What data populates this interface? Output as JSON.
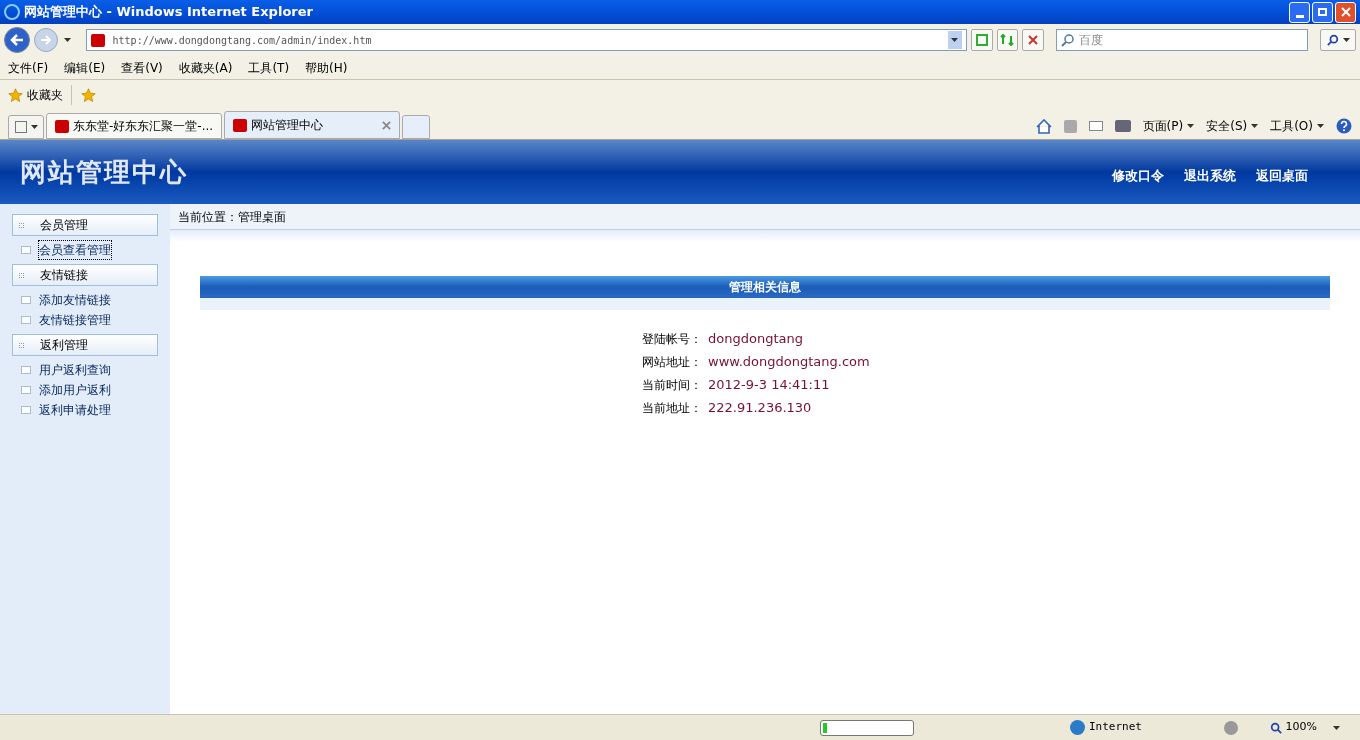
{
  "window": {
    "title": "网站管理中心 - Windows Internet Explorer"
  },
  "address": {
    "url": "http://www.dongdongtang.com/admin/index.htm"
  },
  "search": {
    "placeholder": "百度"
  },
  "menu": [
    "文件(F)",
    "编辑(E)",
    "查看(V)",
    "收藏夹(A)",
    "工具(T)",
    "帮助(H)"
  ],
  "favorites": {
    "label": "收藏夹"
  },
  "tabs": [
    {
      "label": "东东堂-好东东汇聚一堂-...",
      "selected": false
    },
    {
      "label": "网站管理中心",
      "selected": true
    }
  ],
  "command_bar": [
    "页面(P)",
    "安全(S)",
    "工具(O)"
  ],
  "header": {
    "title": "网站管理中心",
    "links": [
      "修改口令",
      "退出系统",
      "返回桌面"
    ]
  },
  "sidebar": {
    "groups": [
      {
        "title": "会员管理",
        "items": [
          {
            "label": "会员查看管理",
            "selected": true
          }
        ]
      },
      {
        "title": "友情链接",
        "items": [
          {
            "label": "添加友情链接",
            "selected": false
          },
          {
            "label": "友情链接管理",
            "selected": false
          }
        ]
      },
      {
        "title": "返利管理",
        "items": [
          {
            "label": "用户返利查询",
            "selected": false
          },
          {
            "label": "添加用户返利",
            "selected": false
          },
          {
            "label": "返利申请处理",
            "selected": false
          }
        ]
      }
    ]
  },
  "breadcrumb": "当前位置：管理桌面",
  "panel": {
    "title": "管理相关信息",
    "fields": [
      {
        "label": "登陆帐号：",
        "value": "dongdongtang"
      },
      {
        "label": "网站地址：",
        "value": "www.dongdongtang.com"
      },
      {
        "label": "当前时间：",
        "value": "2012-9-3 14:41:11"
      },
      {
        "label": "当前地址：",
        "value": "222.91.236.130"
      }
    ]
  },
  "status_bar": {
    "progress": {
      "level": 0.05
    },
    "zone": "Internet",
    "zoom": "100%"
  }
}
